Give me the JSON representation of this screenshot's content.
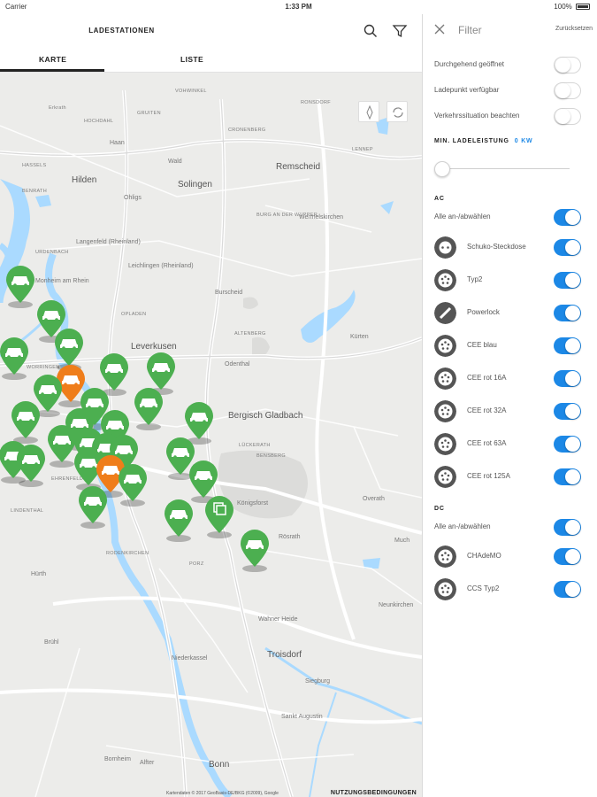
{
  "status_bar": {
    "carrier": "Carrier",
    "time": "1:33 PM",
    "battery": "100%"
  },
  "header": {
    "title": "LADESTATIONEN",
    "tabs": [
      "KARTE",
      "LISTE"
    ],
    "active_tab": "KARTE"
  },
  "map": {
    "labels": {
      "erkrath": "Erkrath",
      "gruiten": "GRUITEN",
      "hochdahl": "HOCHDAHL",
      "vohwinkel": "VOHWINKEL",
      "ronsdorf": "RONSDORF",
      "cronenberg": "CRONENBERG",
      "lennep": "LENNEP",
      "haan": "Haan",
      "wald": "Wald",
      "remscheid": "Remscheid",
      "hasseis": "HASSELS",
      "hilden": "Hilden",
      "solingen": "Solingen",
      "ohligs": "Ohligs",
      "benrath": "BENRATH",
      "burg": "BURG AN DER WUPPER",
      "bergisch_born": "Wermelskirchen",
      "urdenbach": "URDENBACH",
      "langenfeld": "Langenfeld (Rheinland)",
      "leichlingen": "Leichlingen (Rheinland)",
      "monheim": "Monheim am Rhein",
      "burscheid": "Burscheid",
      "opladen": "OPLADEN",
      "leverkusen": "Leverkusen",
      "altenberg": "ALTENBERG",
      "kurten": "Kürten",
      "odenthal": "Odenthal",
      "bergisch_gladbach": "Bergisch Gladbach",
      "luckerath": "LÜCKERATH",
      "bensberg": "BENSBERG",
      "koenigsforst": "Königsforst",
      "overath": "Overath",
      "rosrath": "Rösrath",
      "porz": "PORZ",
      "wahner_heide": "Wahner Heide",
      "troisdorf": "Troisdorf",
      "niederkassel": "Niederkassel",
      "siegburg": "Siegburg",
      "sankt_augustin": "Sankt Augustin",
      "bornheim": "Bornheim",
      "alfter": "Alfter",
      "bonn": "Bonn",
      "hurth": "Hürth",
      "bruhl": "Brühl",
      "rodenkirchen": "RODENKIRCHEN",
      "lindenthal": "LINDENTHAL",
      "ehrenfeld": "EHRENFELD",
      "worringen": "WORRINGEN",
      "neunkirchen": "Neunkirchen",
      "much": "Much"
    },
    "footer_copyright": "Kartendaten © 2017 GeoBasis-DE/BKG (©2009), Google",
    "footer_terms": "NUTZUNGSBEDINGUNGEN",
    "pin_colors": {
      "green": "#4caf50",
      "orange": "#ef7d1a"
    }
  },
  "filter": {
    "title": "Filter",
    "reset": "Zurücksetzen",
    "general": [
      {
        "label": "Durchgehend geöffnet",
        "on": false
      },
      {
        "label": "Ladepunkt verfügbar",
        "on": false
      },
      {
        "label": "Verkehrssituation beachten",
        "on": false
      }
    ],
    "min_power_title": "MIN. LADELEISTUNG",
    "min_power_value": "0 KW",
    "ac_title": "AC",
    "ac_all": "Alle an-/abwählen",
    "ac_items": [
      {
        "label": "Schuko-Steckdose",
        "icon": "schuko-plug-icon",
        "on": true
      },
      {
        "label": "Typ2",
        "icon": "typ2-plug-icon",
        "on": true
      },
      {
        "label": "Powerlock",
        "icon": "powerlock-plug-icon",
        "on": true
      },
      {
        "label": "CEE blau",
        "icon": "cee-blau-plug-icon",
        "on": true
      },
      {
        "label": "CEE rot 16A",
        "icon": "cee-rot-16a-plug-icon",
        "on": true
      },
      {
        "label": "CEE rot 32A",
        "icon": "cee-rot-32a-plug-icon",
        "on": true
      },
      {
        "label": "CEE rot 63A",
        "icon": "cee-rot-63a-plug-icon",
        "on": true
      },
      {
        "label": "CEE rot 125A",
        "icon": "cee-rot-125a-plug-icon",
        "on": true
      }
    ],
    "dc_title": "DC",
    "dc_all": "Alle an-/abwählen",
    "dc_items": [
      {
        "label": "CHAdeMO",
        "icon": "chademo-plug-icon",
        "on": true
      },
      {
        "label": "CCS Typ2",
        "icon": "ccs-typ2-plug-icon",
        "on": true
      }
    ],
    "accent_color": "#1c88e6"
  }
}
